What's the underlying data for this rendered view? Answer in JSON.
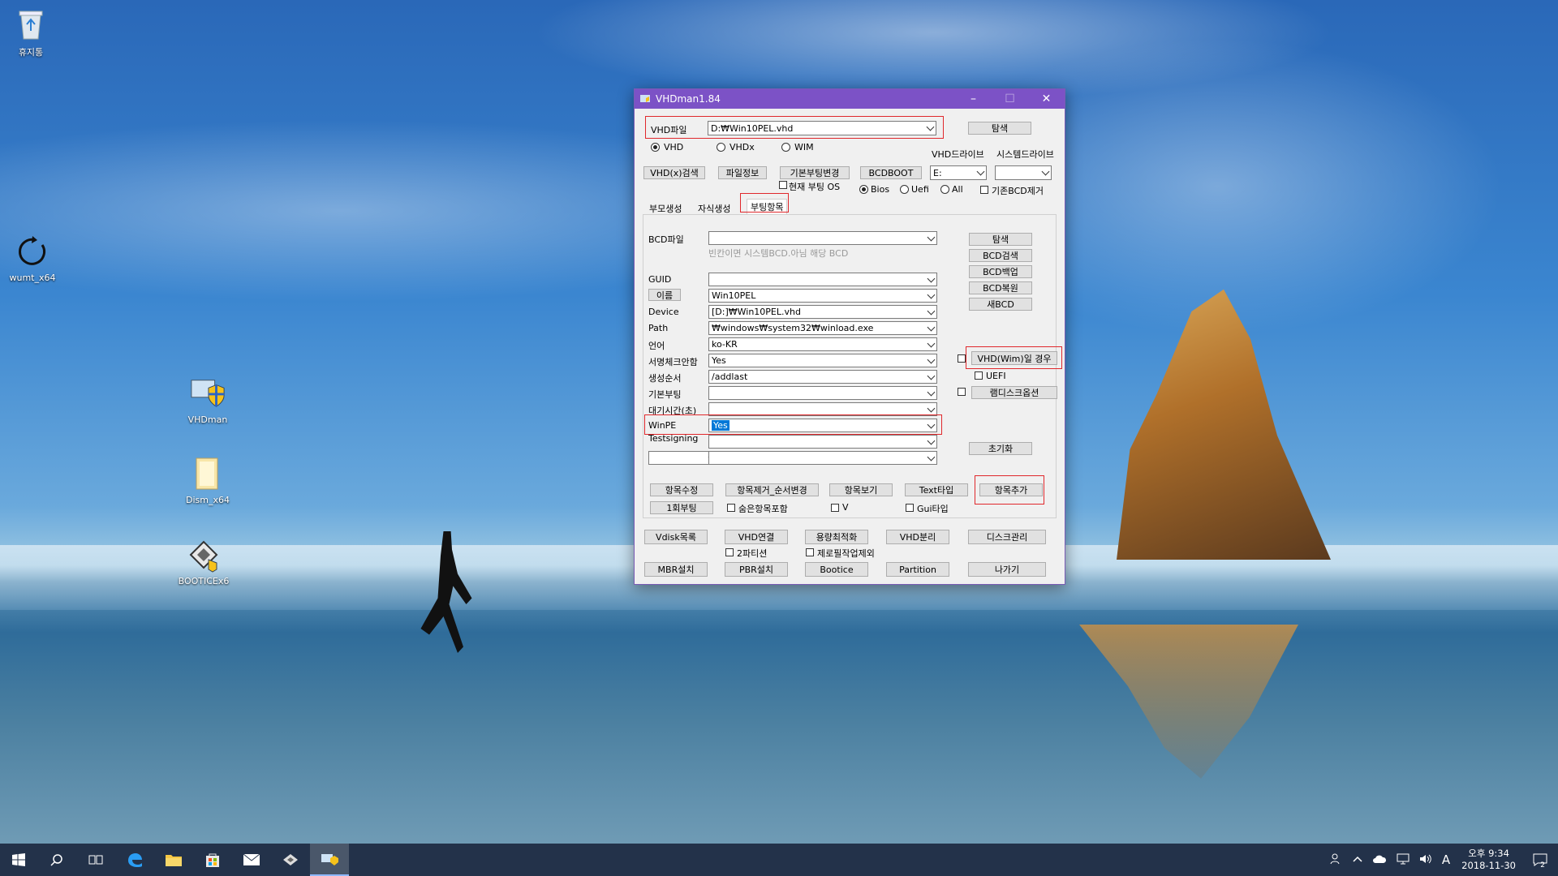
{
  "desktop": {
    "icons": [
      {
        "label": "휴지통",
        "icon": "recycle-bin-icon"
      },
      {
        "label": "wumt_x64",
        "icon": "refresh-icon"
      },
      {
        "label": "VHDman",
        "icon": "shield-computer-icon"
      },
      {
        "label": "Dism_x64",
        "icon": "folder-icon"
      },
      {
        "label": "BOOTICEx6",
        "icon": "installer-icon"
      }
    ]
  },
  "window": {
    "title": "VHDman1.84",
    "vhd_file_label": "VHD파일",
    "vhd_file_value": "D:₩Win10PEL.vhd",
    "browse_label": "탐색",
    "format_options": [
      "VHD",
      "VHDx",
      "WIM"
    ],
    "format_selected": "VHD",
    "vhd_drive_label": "VHD드라이브",
    "system_drive_label": "시스템드라이브",
    "vhd_drive_value": "E:",
    "system_drive_value": "",
    "vhdx_search_label": "VHD(x)검색",
    "file_info_label": "파일정보",
    "default_boot_change_label": "기본부팅변경",
    "bcdboot_label": "BCDBOOT",
    "current_boot_os_label": "현재 부팅 OS",
    "boot_mode_options": [
      "Bios",
      "Uefi",
      "All"
    ],
    "boot_mode_selected": "Bios",
    "remove_existing_bcd_label": "기존BCD제거",
    "tabs": [
      "부모생성",
      "자식생성",
      "부팅항목"
    ],
    "active_tab": "부팅항목",
    "bcd_file_label": "BCD파일",
    "bcd_file_value": "",
    "bcd_hint": "빈칸이면 시스템BCD.아님 해당 BCD",
    "side_buttons": [
      "탐색",
      "BCD검색",
      "BCD백업",
      "BCD복원",
      "새BCD"
    ],
    "fields": [
      {
        "label": "GUID",
        "value": ""
      },
      {
        "label": "이름",
        "value": "Win10PEL"
      },
      {
        "label": "Device",
        "value": "[D:]₩Win10PEL.vhd"
      },
      {
        "label": "Path",
        "value": "₩windows₩system32₩winload.exe"
      },
      {
        "label": "언어",
        "value": "ko-KR"
      },
      {
        "label": "서명체크안함",
        "value": "Yes"
      },
      {
        "label": "생성순서",
        "value": "/addlast"
      },
      {
        "label": "기본부팅",
        "value": ""
      },
      {
        "label": "대기시간(초)",
        "value": ""
      },
      {
        "label": "WinPE",
        "value": "Yes"
      },
      {
        "label": "Testsigning",
        "value": ""
      }
    ],
    "vhd_wim_label": "VHD(Wim)일 경우",
    "uefi_label": "UEFI",
    "ramdisk_option_label": "램디스크옵션",
    "reset_label": "초기화",
    "action_buttons": [
      "항목수정",
      "항목제거_순서변경",
      "항목보기",
      "Text타입",
      "항목추가"
    ],
    "one_time_boot_label": "1회부팅",
    "include_hidden_label": "숨은항목포함",
    "v_label": "V",
    "gui_type_label": "Gui타입",
    "bottom_row1": [
      "Vdisk목록",
      "VHD연결",
      "용량최적화",
      "VHD분리",
      "디스크관리"
    ],
    "partition2_label": "2파티션",
    "exclude_zero_fill_label": "제로필작업제외",
    "bottom_row2": [
      "MBR설치",
      "PBR설치",
      "Bootice",
      "Partition",
      "나가기"
    ]
  },
  "taskbar": {
    "time": "오후 9:34",
    "date": "2018-11-30",
    "ime": "A",
    "notification_count": "2"
  },
  "colors": {
    "titlebar": "#7c52c6",
    "highlight_box": "#e0282c",
    "selection": "#0078d7",
    "taskbar": "#23324a"
  }
}
